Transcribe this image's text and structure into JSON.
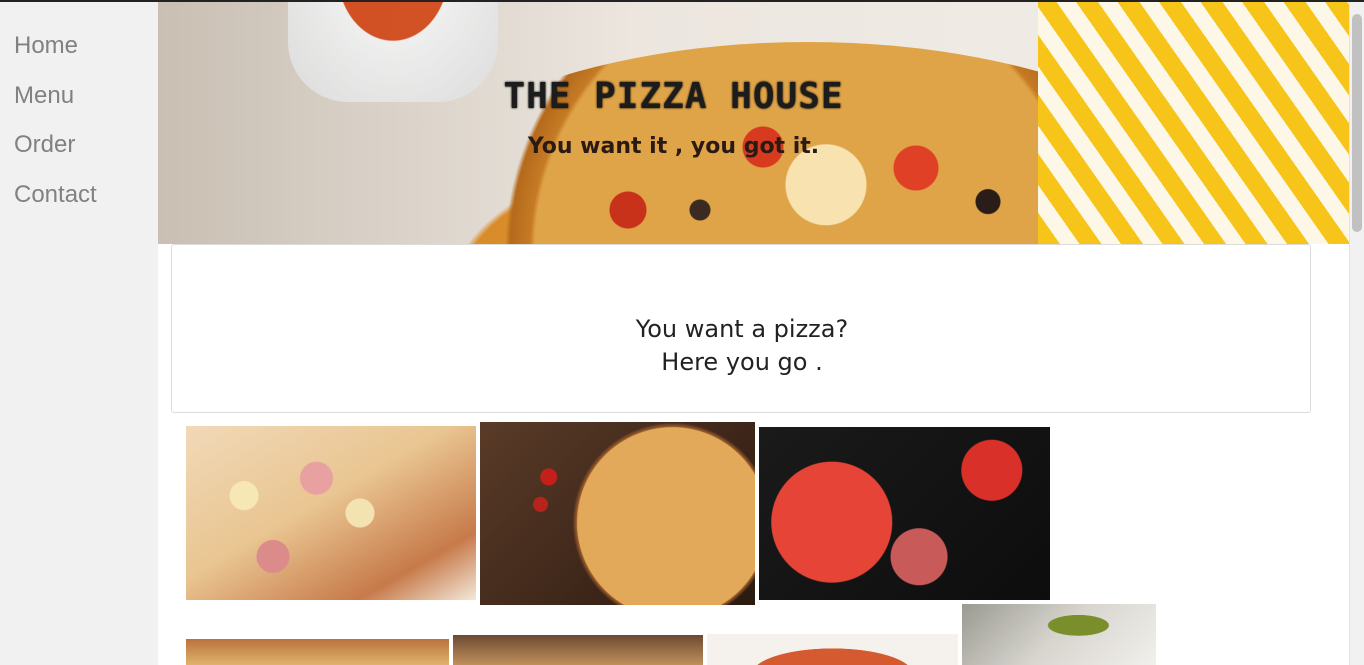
{
  "sidebar": {
    "items": [
      {
        "label": "Home"
      },
      {
        "label": "Menu"
      },
      {
        "label": "Order"
      },
      {
        "label": "Contact"
      }
    ]
  },
  "header": {
    "title": "THE PIZZA HOUSE",
    "subtitle": "You want it , you got it."
  },
  "intro": {
    "line1": "You want a pizza?",
    "line2": "Here you go ."
  },
  "gallery": {
    "images": [
      {
        "name": "pizza-photo-ham-pineapple"
      },
      {
        "name": "pizza-photo-wood-table"
      },
      {
        "name": "pizza-photo-pepperoni-dark"
      },
      {
        "name": "pizza-photo-4"
      },
      {
        "name": "pizza-photo-5"
      },
      {
        "name": "pizza-photo-6"
      },
      {
        "name": "pizza-photo-avocado"
      }
    ]
  },
  "colors": {
    "sidebar_bg": "#f1f1f1",
    "sidebar_text": "#818181",
    "card_border": "#dcdcdc"
  }
}
